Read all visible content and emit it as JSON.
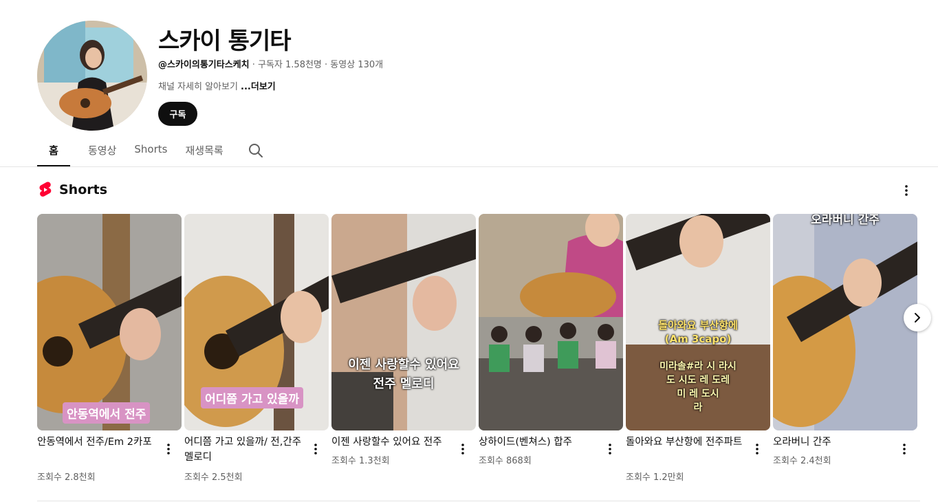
{
  "channel": {
    "title": "스카이 통기타",
    "handle": "@스카이의통기타스케치",
    "stats": " · 구독자 1.58천명 · 동영상 130개",
    "description": "채널 자세히 알아보기 ",
    "more_label": "...더보기",
    "subscribe_label": "구독"
  },
  "tabs": [
    {
      "label": "홈",
      "active": true
    },
    {
      "label": "동영상",
      "active": false
    },
    {
      "label": "Shorts",
      "active": false
    },
    {
      "label": "재생목록",
      "active": false
    }
  ],
  "shelf": {
    "title": "Shorts",
    "items": [
      {
        "title": "안동역에서 전주/Em 2카포",
        "views": "조회수 2.8천회",
        "overlay": "안동역에서 전주"
      },
      {
        "title": "어디쯤 가고 있을까/ 전,간주멜로디",
        "views": "조회수 2.5천회",
        "overlay": "어디쯤 가고 있을까"
      },
      {
        "title": "이젠 사랑할수 있어요 전주",
        "views": "조회수 1.3천회",
        "overlay": "이젠 사랑할수 있어요\n전주 멜로디"
      },
      {
        "title": "상하이드(벤쳐스) 합주",
        "views": "조회수 868회",
        "overlay": ""
      },
      {
        "title": "돌아와요 부산항에  전주파트",
        "views": "조회수 1.2만회",
        "overlay": "돌아와요 부산항에\n(Am 3capo)",
        "overlay2": "미라솔#라 시 라시\n도 시도 레 도레\n미 레 도시\n라"
      },
      {
        "title": "오라버니 간주",
        "views": "조회수 2.4천회",
        "overlay": "오라버니 간주"
      }
    ]
  },
  "icons": {
    "search": "search-icon",
    "shorts_logo": "shorts-logo-icon",
    "more": "more-vert-icon",
    "next": "chevron-right-icon"
  },
  "colors": {
    "accent_red": "#ff0033",
    "button_dark": "#0f0f0f",
    "pill_pink": "#d893c4"
  }
}
